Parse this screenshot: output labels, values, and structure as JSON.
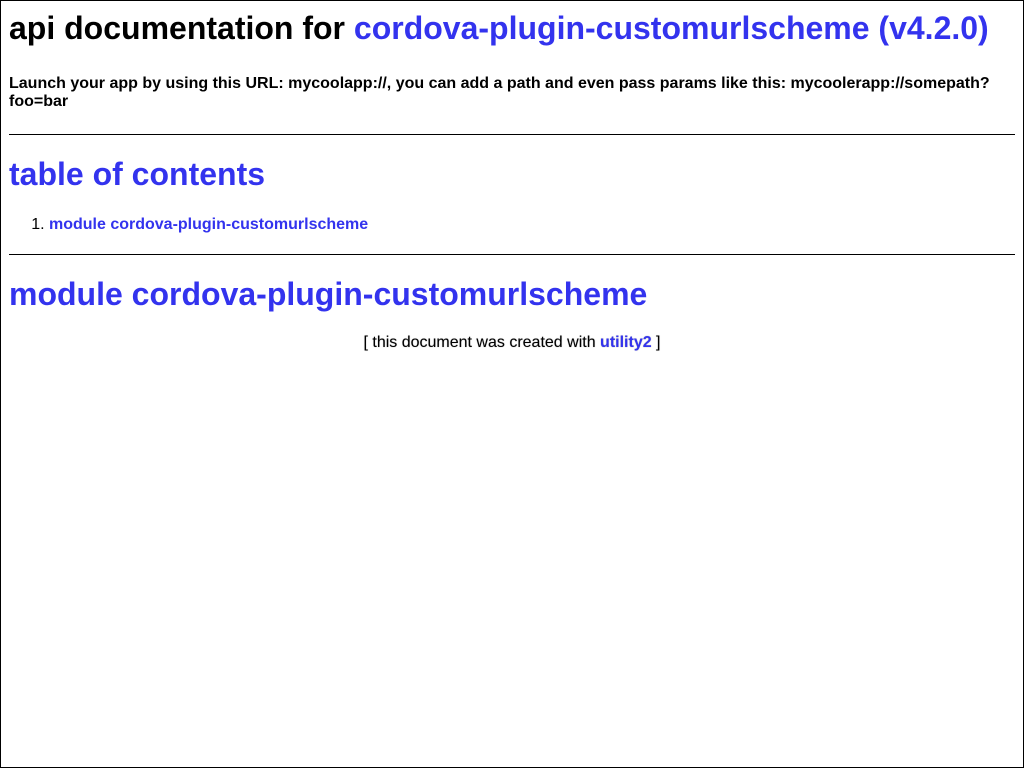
{
  "header": {
    "title_prefix": "api documentation for ",
    "package_link": "cordova-plugin-customurlscheme (v4.2.0)"
  },
  "description": "Launch your app by using this URL: mycoolapp://, you can add a path and even pass params like this: mycoolerapp://somepath?foo=bar",
  "toc": {
    "title": "table of contents",
    "items": [
      {
        "label": "module cordova-plugin-customurlscheme"
      }
    ]
  },
  "module": {
    "title": "module cordova-plugin-customurlscheme"
  },
  "footer": {
    "prefix": "[ this document was created with ",
    "link": "utility2",
    "suffix": " ]"
  },
  "colors": {
    "link": "#3333ee",
    "text": "#000000",
    "background": "#ffffff"
  }
}
